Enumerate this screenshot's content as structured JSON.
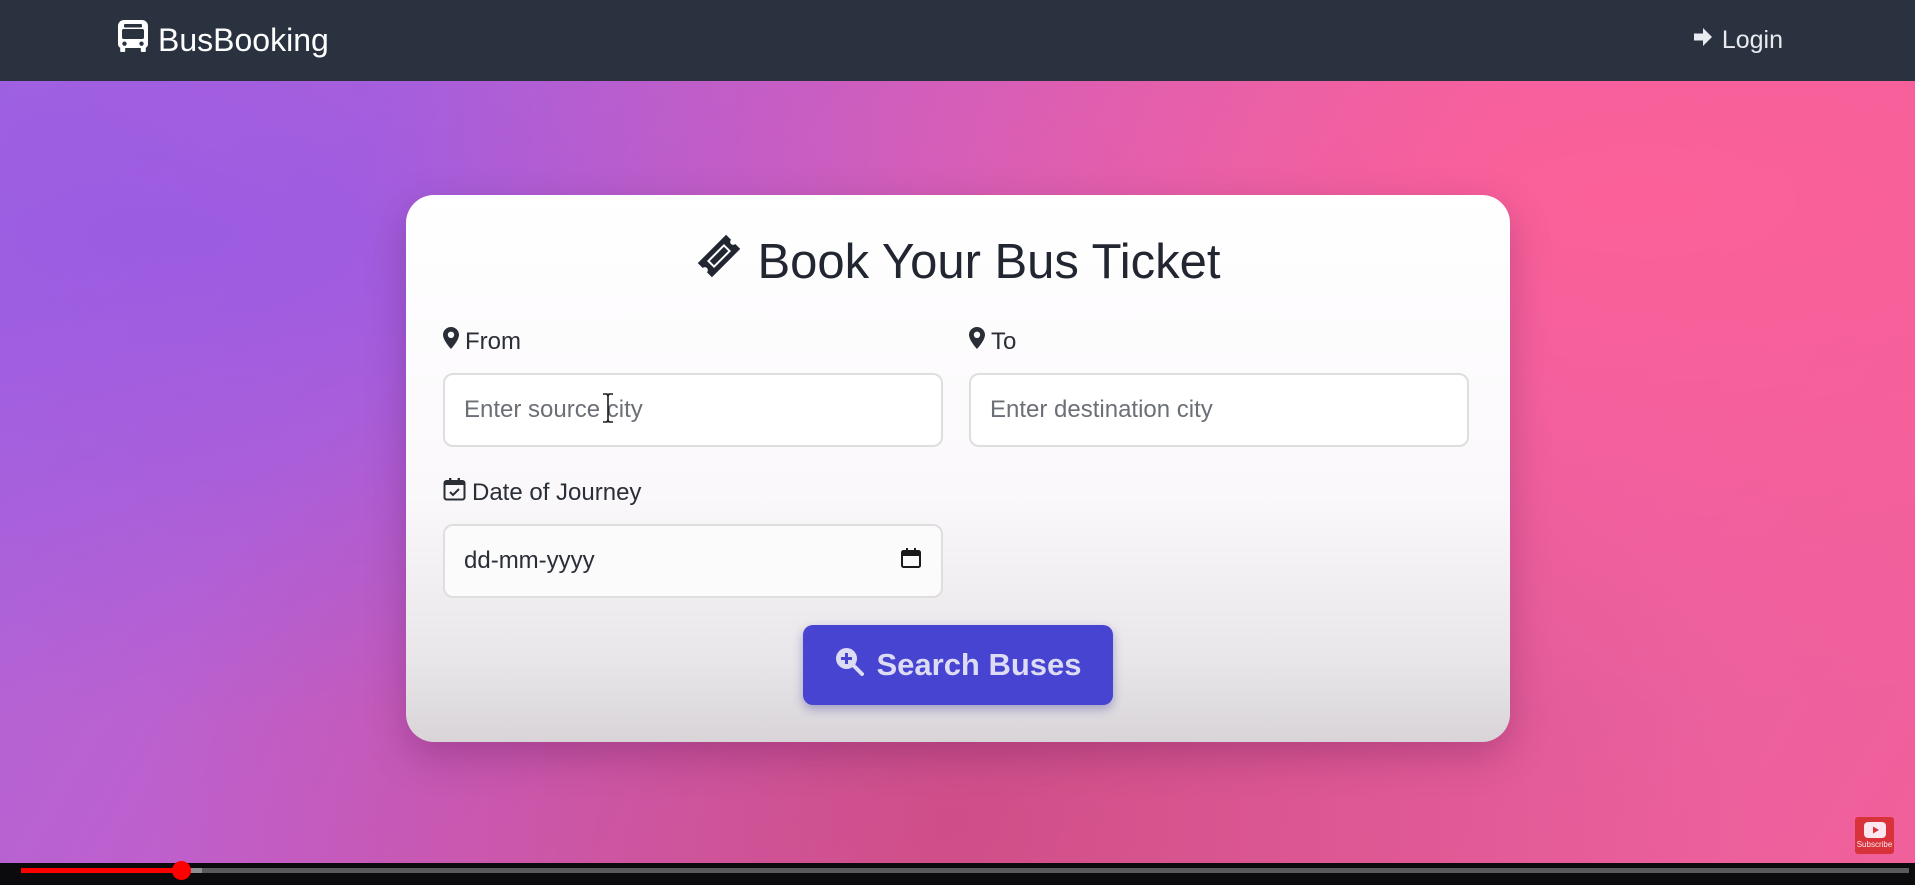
{
  "navbar": {
    "brand_label": "BusBooking",
    "brand_icon": "bus-icon",
    "login_label": "Login",
    "login_icon": "sign-in-arrow-icon"
  },
  "booking_card": {
    "title": "Book Your Bus Ticket",
    "title_icon": "ticket-icon",
    "from": {
      "label": "From",
      "icon": "map-pin-icon",
      "value": "",
      "placeholder": "Enter source city"
    },
    "to": {
      "label": "To",
      "icon": "map-pin-icon",
      "value": "",
      "placeholder": "Enter destination city"
    },
    "date": {
      "label": "Date of Journey",
      "icon": "calendar-check-icon",
      "placeholder": "dd-mm-yyyy",
      "picker_icon": "calendar-icon"
    },
    "search_button": {
      "label": "Search Buses",
      "icon": "search-plus-icon"
    }
  },
  "video_player": {
    "progress_fraction": 0.085,
    "buffered_fraction": 0.096,
    "subscribe_label": "Subscribe"
  },
  "colors": {
    "navbar_bg": "#2a3240",
    "button_bg": "#4744d2",
    "progress_red": "#ff0000"
  }
}
